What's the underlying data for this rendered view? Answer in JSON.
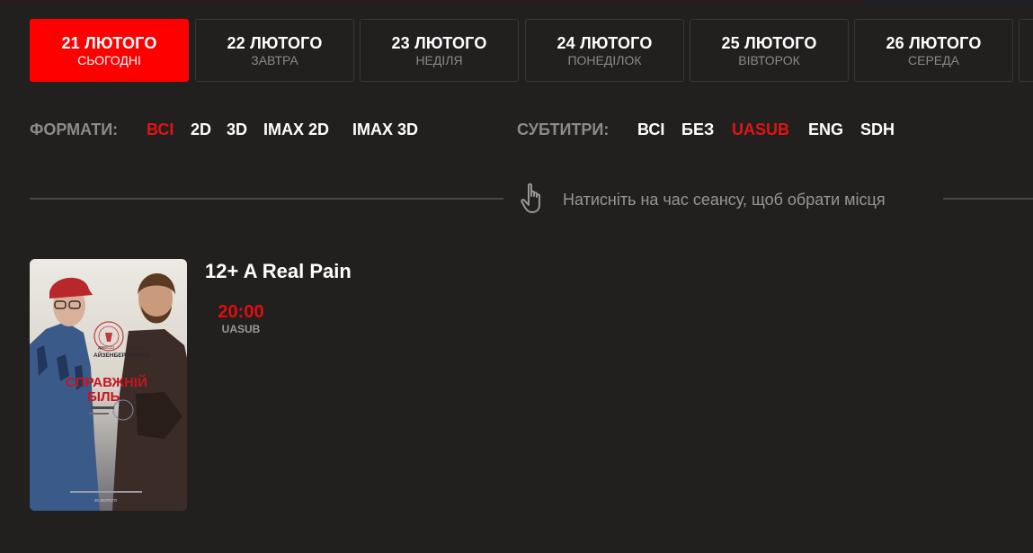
{
  "colors": {
    "background": "#221f1f",
    "accent": "#ff0000",
    "selected_filter": "#e11414",
    "session_time": "#e10d0d"
  },
  "dates": [
    {
      "date": "21 ЛЮТОГО",
      "day": "СЬОГОДНІ",
      "active": true
    },
    {
      "date": "22 ЛЮТОГО",
      "day": "ЗАВТРА"
    },
    {
      "date": "23 ЛЮТОГО",
      "day": "НЕДІЛЯ"
    },
    {
      "date": "24 ЛЮТОГО",
      "day": "ПОНЕДІЛОК"
    },
    {
      "date": "25 ЛЮТОГО",
      "day": "ВІВТОРОК"
    },
    {
      "date": "26 ЛЮТОГО",
      "day": "СЕРЕДА"
    }
  ],
  "filters": {
    "formats_label": "ФОРМАТИ:",
    "formats": [
      "ВСІ",
      "2D",
      "3D",
      "IMAX 2D",
      "IMAX 3D"
    ],
    "formats_selected": "ВСІ",
    "subtitles_label": "СУБТИТРИ:",
    "subtitles": [
      "ВСІ",
      "БЕЗ",
      "UASUB",
      "ENG",
      "SDH"
    ],
    "subtitles_selected": "UASUB"
  },
  "hint": {
    "icon": "hand-pointer-icon",
    "text": "Натисніть на час сеансу, щоб обрати місця"
  },
  "movie": {
    "title": "12+ A Real Pain",
    "poster": {
      "title_line1": "СПРАВЖНІЙ",
      "title_line2": "БІЛЬ",
      "actor_left": "ДЖЕССІ АЙЗЕНБЕРГ",
      "actor_right": "КІРАН КАЛКІН",
      "release": "20 ЛЮТОГО"
    },
    "sessions": [
      {
        "time": "20:00",
        "format": "UASUB"
      }
    ]
  }
}
